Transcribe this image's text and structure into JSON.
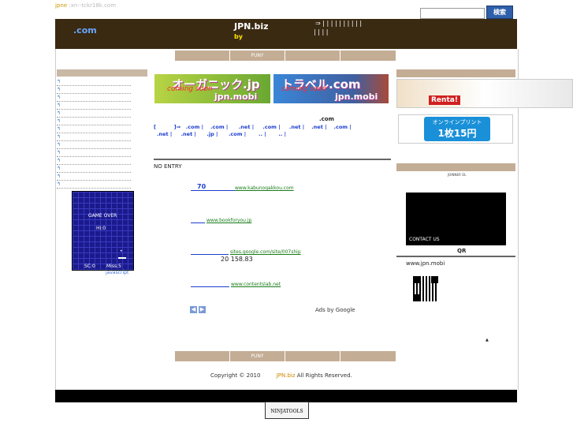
{
  "topbar": {
    "domain_prefix": "jpne",
    "domain_text": ":xn--tckr18k.com",
    "search_placeholder": "",
    "search_button": "検索"
  },
  "header": {
    "domain": ".com",
    "site_name": "JPN.biz",
    "by": "by",
    "nav_row1": "⇒    |    |    |    |    |    |    |    |    |    |",
    "nav_row2": "|    |    |    |"
  },
  "tabs_top": [
    "",
    "PUNY",
    "",
    ""
  ],
  "tabs_bottom": [
    "",
    "PUNY",
    "",
    ""
  ],
  "sidebar": {
    "items": [
      "↰",
      "↰",
      "↰",
      "↰",
      "↰",
      "↰",
      "↰",
      "↰",
      "↰",
      "↰",
      "↰",
      "↰",
      "↰",
      "↰"
    ]
  },
  "game": {
    "line1": "GAME OVER",
    "line2": "HI:0",
    "score": "SC:0",
    "miss": "Miss:5",
    "caption": "javascript"
  },
  "banners": [
    {
      "title": "オーガニック.jp",
      "coming": "coming soon",
      "brand": "jpn.mobi",
      "bg": "#6aa832"
    },
    {
      "title": "トラベル.com",
      "coming": "coming soon",
      "brand": "jpn.mobi",
      "bg": "#2a6dc4"
    }
  ],
  "domains": {
    "heading": ".com",
    "line1": "[          ]⇒   .com |    .com |      .net |     .com |     .net |    .net |    .com |",
    "line2": ".net |     .net |      .jp |      .com |       .. |       .. |"
  },
  "main": {
    "no_entry": "NO ENTRY"
  },
  "ads": [
    {
      "title": "70",
      "url": "www.kabunogakkou.com"
    },
    {
      "title": "",
      "url": "www.bookforyou.jp"
    },
    {
      "title": "",
      "url": "sites.google.com/site/007ship",
      "extra": "20   158.83"
    },
    {
      "title": "",
      "url": "www.contentslab.net"
    }
  ],
  "ads_by": "Ads by Google",
  "right": {
    "renta_text": "Renta!",
    "print_line1": "オンラインプリント",
    "print_line2": "1枚15円",
    "joinner": "JOINNER OL",
    "contact": "CONTACT US",
    "qr_title": "QR",
    "qr_url": "www.jpn.mobi",
    "arrow": "▲"
  },
  "footer": {
    "copyright": "Copyright © 2010",
    "brand": "JPN.biz",
    "rights": "All Rights Reserved."
  },
  "ninja": "NINJATOOLS",
  "colors": {
    "header_bg": "#3a2a12",
    "tab": "#c4ad95",
    "link": "#1d3ed0",
    "url": "#1a7c1a"
  }
}
